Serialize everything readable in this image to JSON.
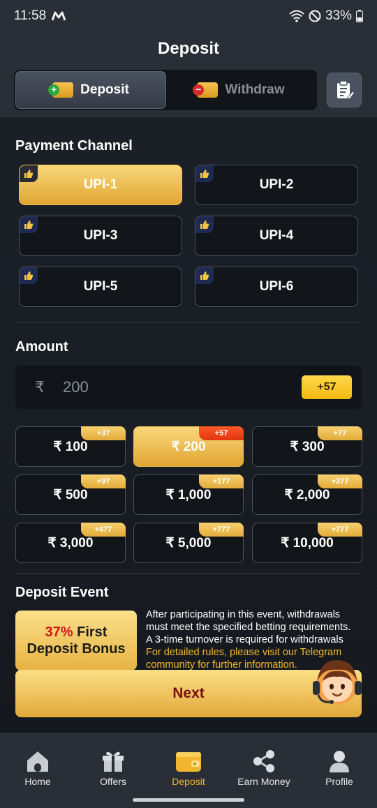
{
  "status_bar": {
    "time": "11:58",
    "battery": "33%"
  },
  "header": {
    "title": "Deposit"
  },
  "tabs": [
    {
      "label": "Deposit",
      "active": true
    },
    {
      "label": "Withdraw",
      "active": false
    }
  ],
  "payment": {
    "title": "Payment Channel",
    "channels": [
      "UPI-1",
      "UPI-2",
      "UPI-3",
      "UPI-4",
      "UPI-5",
      "UPI-6"
    ],
    "selected": "UPI-1"
  },
  "amount": {
    "title": "Amount",
    "currency_symbol": "₹",
    "value": "200",
    "bonus": "+57"
  },
  "presets": [
    {
      "label": "₹ 100",
      "bonus": "+37"
    },
    {
      "label": "₹ 200",
      "bonus": "+57",
      "active": true
    },
    {
      "label": "₹ 300",
      "bonus": "+77"
    },
    {
      "label": "₹ 500",
      "bonus": "+97"
    },
    {
      "label": "₹ 1,000",
      "bonus": "+177"
    },
    {
      "label": "₹ 2,000",
      "bonus": "+377"
    },
    {
      "label": "₹ 3,000",
      "bonus": "+477"
    },
    {
      "label": "₹ 5,000",
      "bonus": "+777"
    },
    {
      "label": "₹ 10,000",
      "bonus": "+777"
    }
  ],
  "event": {
    "title": "Deposit Event",
    "card_percent": "37%",
    "card_line1_rest": " First",
    "card_line2": "Deposit Bonus",
    "text_white": "After participating in this event, withdrawals must meet the specified betting requirements. A 3-time turnover is required for withdrawals",
    "text_gold": "For detailed rules, please visit our Telegram community for further information."
  },
  "next_label": "Next",
  "nav": [
    {
      "label": "Home",
      "icon": "home-icon"
    },
    {
      "label": "Offers",
      "icon": "gift-icon"
    },
    {
      "label": "Deposit",
      "icon": "wallet-icon",
      "active": true
    },
    {
      "label": "Earn Money",
      "icon": "share-icon"
    },
    {
      "label": "Profile",
      "icon": "profile-icon"
    }
  ],
  "colors": {
    "accent_gold": "#f2b62e",
    "background": "#14171c",
    "panel": "#2a2f37",
    "bonus_active": "#e03510"
  }
}
